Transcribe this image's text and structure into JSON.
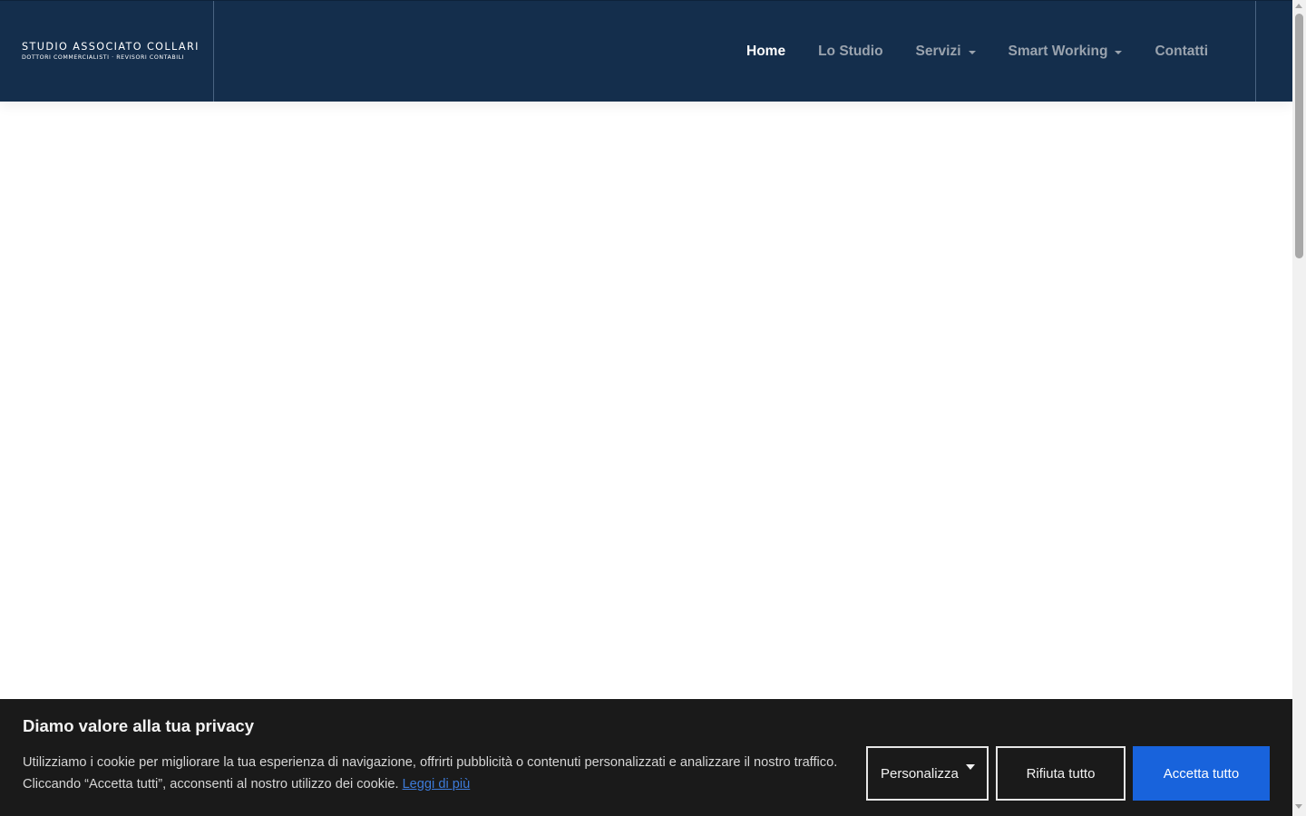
{
  "colors": {
    "header_bg": "#142e4c",
    "nav_active": "#ffffff",
    "nav_inactive": "#9aa3ae",
    "cookie_bg": "#1a1a1a",
    "accept_bg": "#1863dc",
    "link": "#3d7bd9"
  },
  "logo": {
    "line1": "STUDIO ASSOCIATO COLLARI",
    "line2": "DOTTORI COMMERCIALISTI · REVISORI CONTABILI"
  },
  "nav": {
    "items": [
      {
        "label": "Home",
        "active": true
      },
      {
        "label": "Lo Studio"
      },
      {
        "label": "Servizi",
        "dropdown": true
      },
      {
        "label": "Smart Working",
        "dropdown": true
      },
      {
        "label": "Contatti"
      }
    ]
  },
  "cookie": {
    "title": "Diamo valore alla tua privacy",
    "text": "Utilizziamo i cookie per migliorare la tua esperienza di navigazione, offrirti pubblicità o contenuti personalizzati e analizzare il nostro traffico. Cliccando “Accetta tutti”, acconsenti al nostro utilizzo dei cookie.",
    "link": "Leggi di più",
    "buttons": {
      "customize": "Personalizza",
      "reject": "Rifiuta tutto",
      "accept": "Accetta tutto"
    }
  },
  "icons": {
    "dropdown": "caret-down-icon",
    "scroll_up": "scroll-up-arrow-icon",
    "scroll_down": "scroll-down-arrow-icon"
  }
}
